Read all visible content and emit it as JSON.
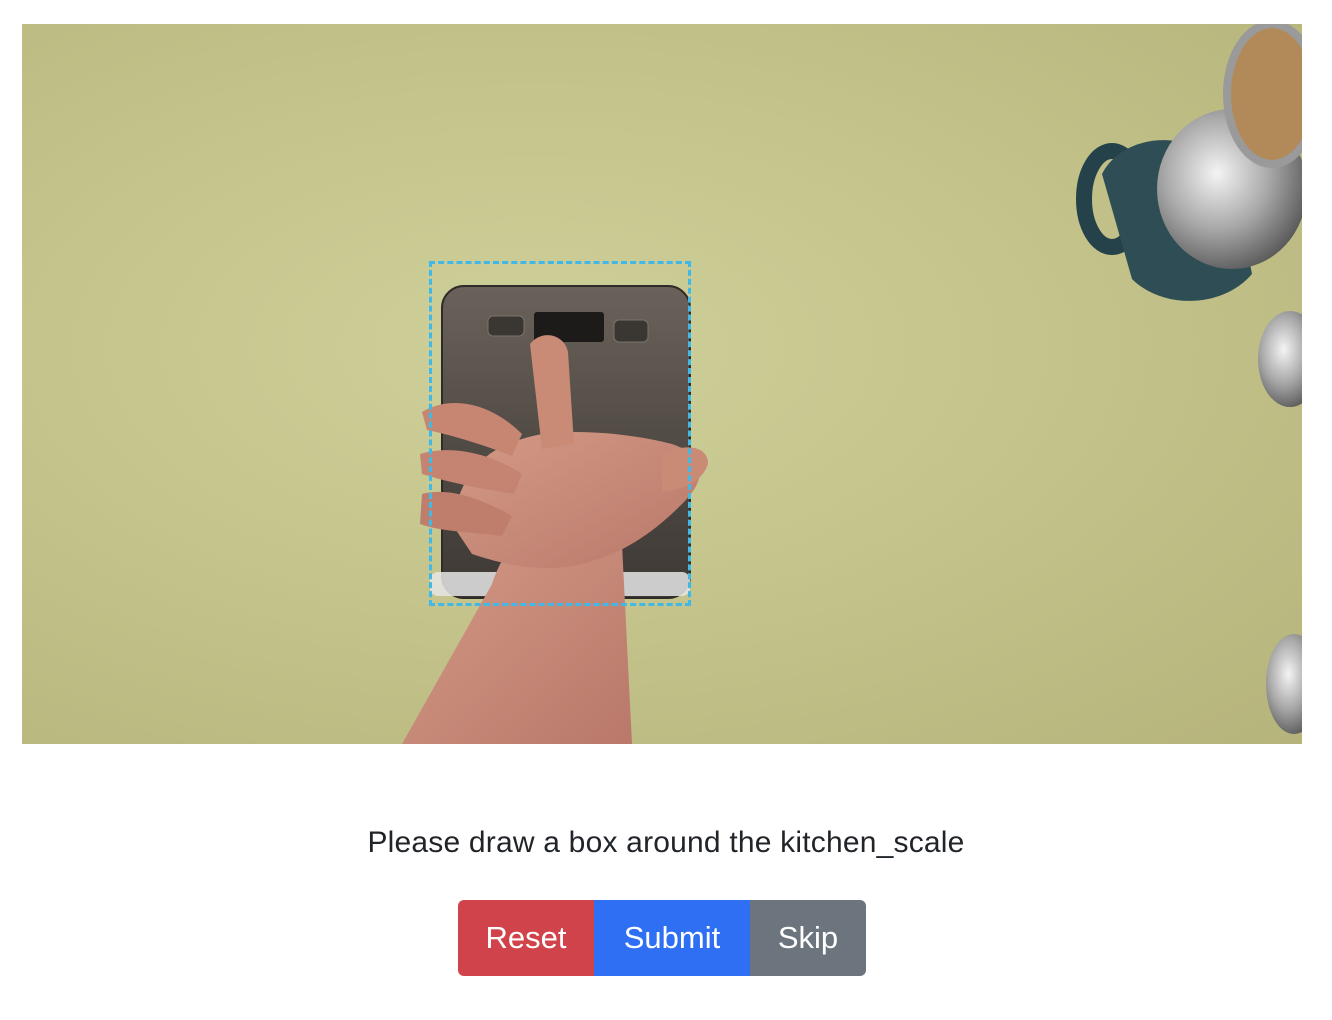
{
  "image": {
    "subject": "kitchen_scale",
    "colors": {
      "tablecloth": "#c4c48c",
      "scale_body": "#5a534c",
      "skin": "#c98a76",
      "mug": "#2f4d55",
      "bbox_stroke": "#41b9e8"
    }
  },
  "prompt": {
    "text": "Please draw a box around the kitchen_scale"
  },
  "buttons": {
    "reset_label": "Reset",
    "submit_label": "Submit",
    "skip_label": "Skip"
  },
  "colors": {
    "reset": "#d1434a",
    "submit": "#2f6ff4",
    "skip": "#6c757d",
    "text": "#212529"
  }
}
